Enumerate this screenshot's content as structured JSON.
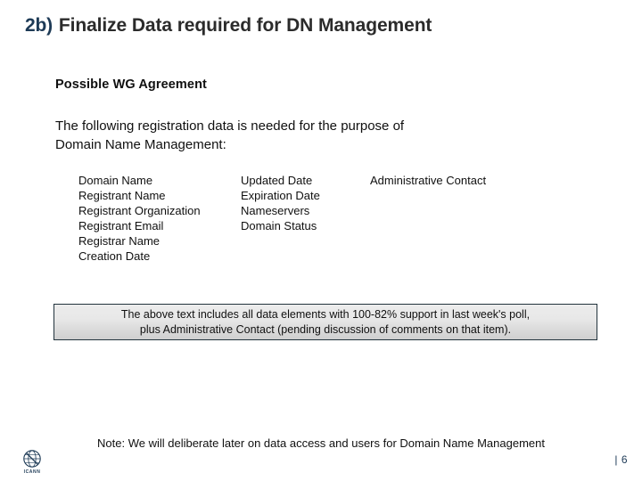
{
  "slide": {
    "title": {
      "number": "2b)",
      "text": "Finalize Data required for DN Management",
      "number_color": "#1d3a56",
      "text_color": "#2b2b2b"
    },
    "subhead": "Possible WG Agreement",
    "lede": {
      "line1": "The following registration data is needed for the purpose of",
      "line2": "Domain Name Management:"
    },
    "data_columns": [
      {
        "items": [
          "Domain Name",
          "Registrant Name",
          "Registrant Organization",
          "Registrant Email",
          "Registrar Name",
          "Creation Date"
        ]
      },
      {
        "items": [
          "Updated Date",
          "Expiration Date",
          "Nameservers",
          "Domain Status"
        ]
      },
      {
        "items": [
          "Administrative Contact"
        ]
      }
    ],
    "callout": {
      "line1": "The above text includes all data elements with 100-82% support in last week's poll,",
      "line2": "plus Administrative Contact  (pending discussion of comments on that item).",
      "border_color": "#22333d",
      "fill_top": "#ececec",
      "fill_bottom": "#cfcfcf"
    },
    "note": "Note: We will deliberate later on data access and users for Domain Name Management",
    "footer": {
      "logo_wordmark": "ICANN",
      "page_number": "| 6",
      "accent_color": "#1d3a56"
    }
  }
}
